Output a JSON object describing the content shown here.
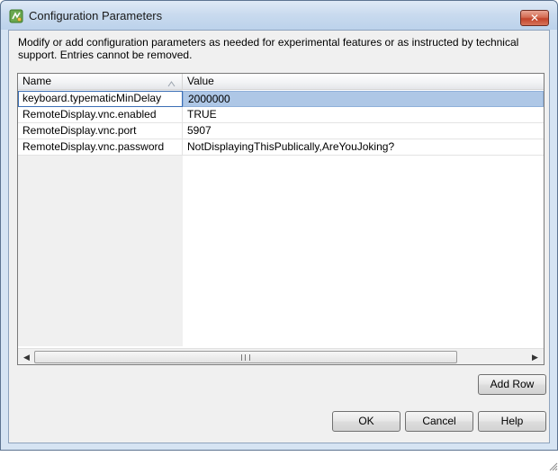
{
  "window": {
    "title": "Configuration Parameters",
    "close_label": "✕"
  },
  "description": "Modify or add configuration parameters as needed for experimental features or as instructed by technical support. Entries cannot be removed.",
  "table": {
    "columns": {
      "name": "Name",
      "value": "Value"
    },
    "rows": [
      {
        "name": "keyboard.typematicMinDelay",
        "value": "2000000"
      },
      {
        "name": "RemoteDisplay.vnc.enabled",
        "value": "TRUE"
      },
      {
        "name": "RemoteDisplay.vnc.port",
        "value": "5907"
      },
      {
        "name": "RemoteDisplay.vnc.password",
        "value": "NotDisplayingThisPublically,AreYouJoking?"
      }
    ],
    "selected_row": 0
  },
  "buttons": {
    "add_row": "Add Row",
    "ok": "OK",
    "cancel": "Cancel",
    "help": "Help"
  },
  "icons": {
    "app": "vsphere-config-icon",
    "sort": "sort-ascending-icon",
    "scroll_left": "scroll-left-icon",
    "scroll_right": "scroll-right-icon",
    "resize": "resize-grip-icon"
  },
  "colors": {
    "selection": "#aec7e6",
    "close_button": "#c2432a"
  }
}
